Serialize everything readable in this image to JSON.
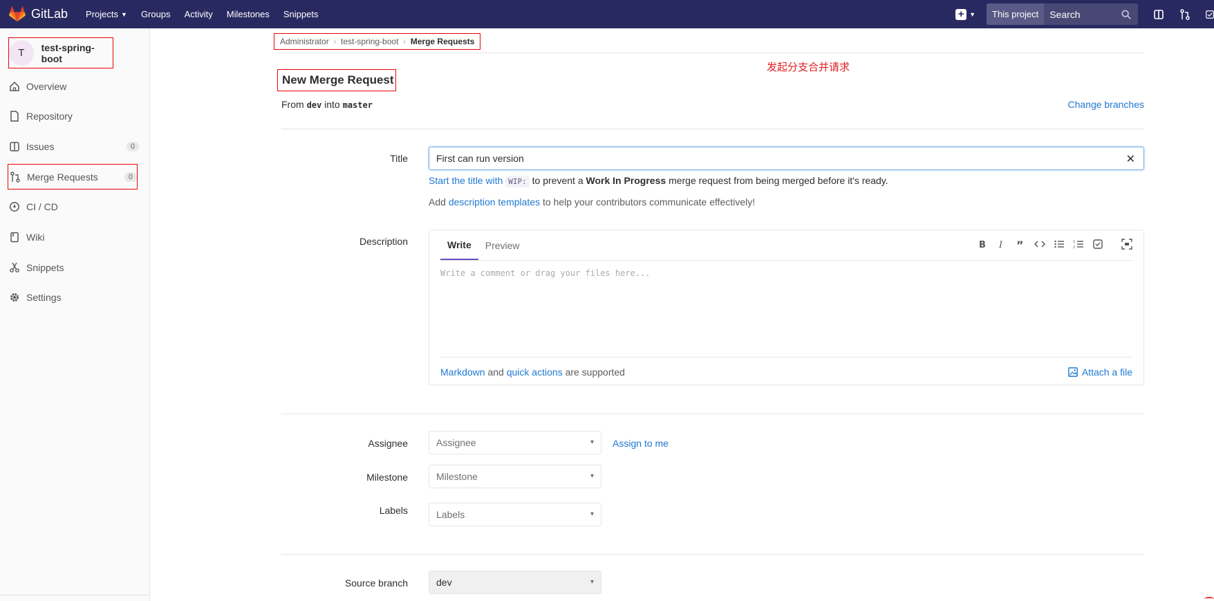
{
  "navbar": {
    "brand": "GitLab",
    "links": [
      "Projects",
      "Groups",
      "Activity",
      "Milestones",
      "Snippets"
    ],
    "search_scope": "This project",
    "search_placeholder": "Search"
  },
  "sidebar": {
    "avatar_letter": "T",
    "project_name": "test-spring-boot",
    "items": [
      {
        "label": "Overview",
        "icon": "home-icon"
      },
      {
        "label": "Repository",
        "icon": "doc-icon"
      },
      {
        "label": "Issues",
        "icon": "issues-icon",
        "count": "0"
      },
      {
        "label": "Merge Requests",
        "icon": "merge-request-icon",
        "count": "0"
      },
      {
        "label": "CI / CD",
        "icon": "rocket-icon"
      },
      {
        "label": "Wiki",
        "icon": "book-icon"
      },
      {
        "label": "Snippets",
        "icon": "scissors-icon"
      },
      {
        "label": "Settings",
        "icon": "gear-icon"
      }
    ]
  },
  "breadcrumb": [
    "Administrator",
    "test-spring-boot",
    "Merge Requests"
  ],
  "page": {
    "title": "New Merge Request",
    "annotation": "发起分支合并请求",
    "from_text": "From",
    "source_branch": "dev",
    "into_text": "into",
    "target_branch": "master",
    "change_branches": "Change branches"
  },
  "form": {
    "title_label": "Title",
    "title_value": "First can run version",
    "wip_hint_link": "Start the title with",
    "wip_code": "WIP:",
    "wip_hint_mid": "to prevent a",
    "wip_hint_bold": "Work In Progress",
    "wip_hint_end": "merge request from being merged before it's ready.",
    "templates_pre": "Add",
    "templates_link": "description templates",
    "templates_post": "to help your contributors communicate effectively!",
    "description_label": "Description",
    "tab_write": "Write",
    "tab_preview": "Preview",
    "editor_placeholder": "Write a comment or drag your files here...",
    "markdown_link": "Markdown",
    "and_text": "and",
    "quick_actions_link": "quick actions",
    "supported_text": "are supported",
    "attach_file": "Attach a file",
    "assignee_label": "Assignee",
    "assignee_value": "Assignee",
    "assign_to_me": "Assign to me",
    "milestone_label": "Milestone",
    "milestone_value": "Milestone",
    "labels_label": "Labels",
    "labels_value": "Labels",
    "source_branch_label": "Source branch",
    "source_branch_value": "dev"
  },
  "colors": {
    "navbar": "#292961",
    "link": "#1f78d1",
    "annotation": "#e02020",
    "active_tab": "#6b4fbb"
  }
}
